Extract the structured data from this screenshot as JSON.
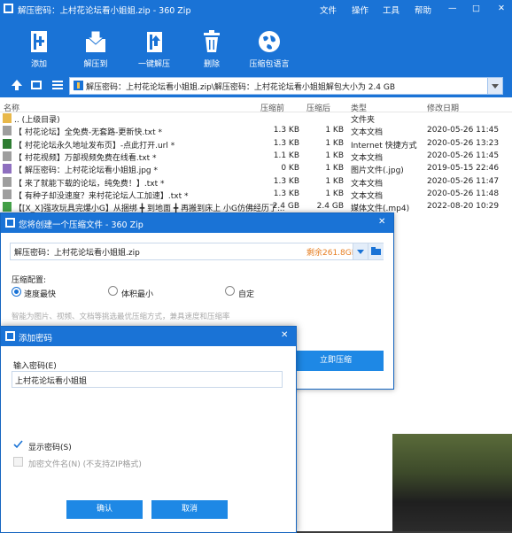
{
  "window": {
    "title": "解压密码：上村花论坛看小姐姐.zip - 360 Zip",
    "menu": [
      "文件",
      "操作",
      "工具",
      "帮助"
    ],
    "controls": [
      "—",
      "□",
      "✕"
    ]
  },
  "toolbar": {
    "items": [
      {
        "label": "添加",
        "icon": "add-icon"
      },
      {
        "label": "解压到",
        "icon": "extract-icon"
      },
      {
        "label": "一键解压",
        "icon": "one-click-extract-icon"
      },
      {
        "label": "删除",
        "icon": "delete-icon"
      },
      {
        "label": "压缩包语言",
        "icon": "globe-icon"
      }
    ]
  },
  "address": {
    "path": "解压密码：上村花论坛看小姐姐.zip\\解压密码：上村花论坛看小姐姐解包大小为 2.4 GB"
  },
  "columns": [
    "名称",
    "压缩前",
    "压缩后",
    "类型",
    "修改日期"
  ],
  "files": [
    {
      "name": ".. (上级目录)",
      "before": "",
      "after": "",
      "type": "文件夹",
      "date": "",
      "icon": "folder-icon",
      "color": "#e8b84a"
    },
    {
      "name": "【 村花论坛】全免费-无套路-更新快.txt *",
      "before": "1.3 KB",
      "after": "1 KB",
      "type": "文本文档",
      "date": "2020-05-26 11:45",
      "icon": "text-file-icon",
      "color": "#9e9e9e"
    },
    {
      "name": "【 村花论坛永久地址发布页】-点此打开.url *",
      "before": "1.3 KB",
      "after": "1 KB",
      "type": "Internet 快捷方式",
      "date": "2020-05-26 13:23",
      "icon": "internet-shortcut-icon",
      "color": "#2e7d32"
    },
    {
      "name": "【 村花视频】万部视频免费在线看.txt *",
      "before": "1.1 KB",
      "after": "1 KB",
      "type": "文本文档",
      "date": "2020-05-26 11:45",
      "icon": "text-file-icon",
      "color": "#9e9e9e"
    },
    {
      "name": "【 解压密码：上村花论坛看小姐姐.jpg *",
      "before": "0 KB",
      "after": "1 KB",
      "type": "图片文件(.jpg)",
      "date": "2019-05-15 22:46",
      "icon": "image-file-icon",
      "color": "#8e6fbf"
    },
    {
      "name": "【 来了就能下载的论坛，纯免费！】.txt *",
      "before": "1.3 KB",
      "after": "1 KB",
      "type": "文本文档",
      "date": "2020-05-26 11:47",
      "icon": "text-file-icon",
      "color": "#9e9e9e"
    },
    {
      "name": "【 有种子却没速度？来村花论坛人工加速】.txt *",
      "before": "1.3 KB",
      "after": "1 KB",
      "type": "文本文档",
      "date": "2020-05-26 11:48",
      "icon": "text-file-icon",
      "color": "#9e9e9e"
    },
    {
      "name": "【[X_X]强攻玩具完爆小G】从捆绑 ╋ 到地面 ╋ 再搬到床上 小G仿佛经历了...",
      "before": "2.4 GB",
      "after": "2.4 GB",
      "type": "媒体文件(.mp4)",
      "date": "2022-08-20 10:29",
      "icon": "video-file-icon",
      "color": "#43a047"
    }
  ],
  "compress_dialog": {
    "title": "您将创建一个压缩文件 - 360 Zip",
    "filename": "解压密码：上村花论坛看小姐姐.zip",
    "free_space": "剩余261.8GB",
    "config_label": "压缩配置:",
    "options": [
      "速度最快",
      "体积最小",
      "自定"
    ],
    "hint": "智能为图片、视频、文档等挑选最优压缩方式，兼具速度和压缩率",
    "start_button": "立即压缩",
    "close": "✕"
  },
  "password_dialog": {
    "title": "添加密码",
    "input_label": "输入密码(E)",
    "password_value": "上村花论坛看小姐姐",
    "show_password": "显示密码(S)",
    "encrypt_names": "加密文件名(N) (不支持ZIP格式)",
    "ok": "确认",
    "cancel": "取消",
    "close": "✕"
  },
  "colors": {
    "accent": "#1a73d6",
    "button": "#1e88e5",
    "warning": "#e67e22"
  }
}
